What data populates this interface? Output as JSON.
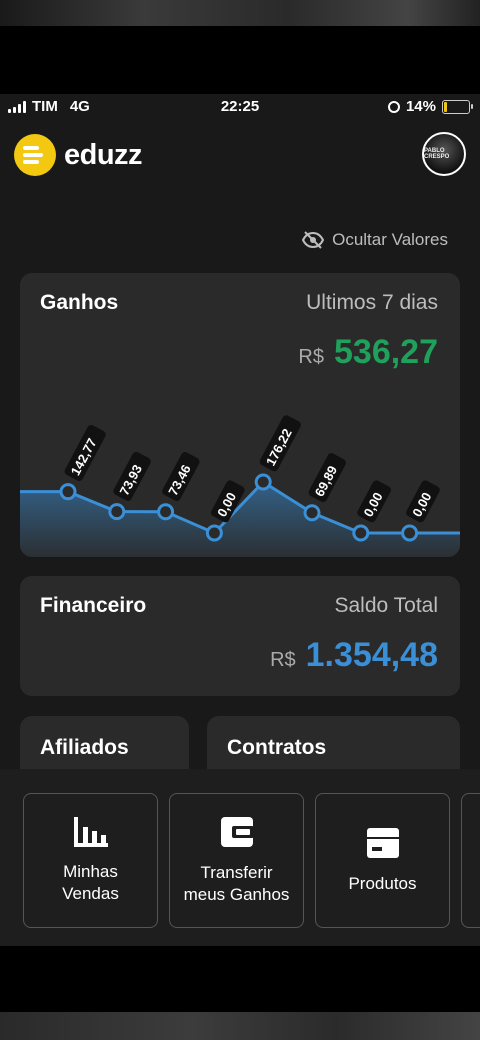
{
  "status_bar": {
    "carrier": "TIM",
    "network": "4G",
    "time": "22:25",
    "battery_percent": "14%",
    "battery_level": 0.14
  },
  "header": {
    "logo_text": "eduzz",
    "avatar_text": "PABLO CRESPO"
  },
  "hide_values": {
    "label": "Ocultar Valores",
    "icon": "eye-off-icon"
  },
  "ganhos": {
    "title": "Ganhos",
    "period": "Ultimos 7 dias",
    "currency": "R$",
    "total": "536,27",
    "accent": "#1fa15b",
    "chart_data": {
      "type": "area",
      "values": [
        142.77,
        73.93,
        73.46,
        0.0,
        176.22,
        69.89,
        0.0,
        0.0
      ],
      "labels": [
        "142,77",
        "73,93",
        "73,46",
        "0,00",
        "176,22",
        "69,89",
        "0,00",
        "0,00"
      ],
      "color": "#3a8fd6"
    }
  },
  "financeiro": {
    "title": "Financeiro",
    "subtitle": "Saldo Total",
    "currency": "R$",
    "total": "1.354,48",
    "accent": "#3a8fd6"
  },
  "afiliados": {
    "title": "Afiliados"
  },
  "contratos": {
    "title": "Contratos"
  },
  "quick_actions": [
    {
      "label_line1": "Minhas",
      "label_line2": "Vendas",
      "icon": "bar-chart-icon"
    },
    {
      "label_line1": "Transferir",
      "label_line2": "meus Ganhos",
      "icon": "wallet-icon"
    },
    {
      "label_line1": "Produtos",
      "label_line2": "",
      "icon": "box-icon"
    }
  ]
}
